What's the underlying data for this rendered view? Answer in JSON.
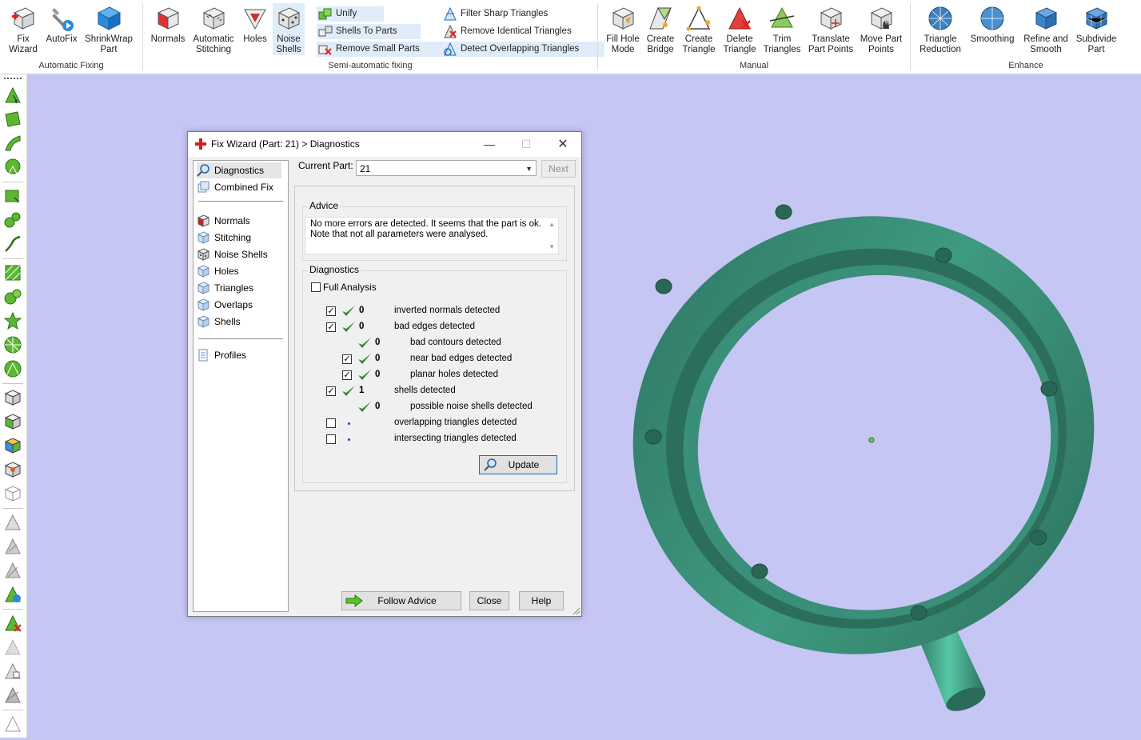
{
  "ribbon": {
    "automatic_fixing": {
      "label": "Automatic Fixing",
      "buttons": [
        {
          "label_1": "Fix",
          "label_2": "Wizard",
          "icon": "fix-wizard-icon"
        },
        {
          "label_1": "AutoFix",
          "label_2": "",
          "icon": "autofix-icon"
        },
        {
          "label_1": "ShrinkWrap",
          "label_2": "Part",
          "icon": "shrinkwrap-icon"
        }
      ]
    },
    "semi_automatic": {
      "label": "Semi-automatic fixing",
      "big_buttons": [
        {
          "label_1": "Normals",
          "label_2": "",
          "icon": "normals-icon"
        },
        {
          "label_1": "Automatic",
          "label_2": "Stitching",
          "icon": "stitching-icon"
        },
        {
          "label_1": "Holes",
          "label_2": "",
          "icon": "holes-icon"
        },
        {
          "label_1": "Noise",
          "label_2": "Shells",
          "icon": "noise-shells-icon"
        }
      ],
      "small_buttons": [
        "Unify",
        "Shells To Parts",
        "Remove Small Parts"
      ],
      "triangle_buttons": [
        "Filter Sharp Triangles",
        "Remove Identical Triangles",
        "Detect Overlapping Triangles"
      ]
    },
    "manual": {
      "label": "Manual",
      "buttons": [
        {
          "label_1": "Fill Hole",
          "label_2": "Mode",
          "icon": "fill-hole-icon"
        },
        {
          "label_1": "Create",
          "label_2": "Bridge",
          "icon": "create-bridge-icon"
        },
        {
          "label_1": "Create",
          "label_2": "Triangle",
          "icon": "create-triangle-icon"
        },
        {
          "label_1": "Delete",
          "label_2": "Triangle",
          "icon": "delete-triangle-icon"
        },
        {
          "label_1": "Trim",
          "label_2": "Triangles",
          "icon": "trim-triangles-icon"
        },
        {
          "label_1": "Translate",
          "label_2": "Part Points",
          "icon": "translate-points-icon"
        },
        {
          "label_1": "Move Part",
          "label_2": "Points",
          "icon": "move-points-icon"
        }
      ]
    },
    "enhance": {
      "label": "Enhance",
      "buttons": [
        {
          "label_1": "Triangle",
          "label_2": "Reduction",
          "icon": "triangle-reduction-icon"
        },
        {
          "label_1": "Smoothing",
          "label_2": "",
          "icon": "smoothing-icon"
        },
        {
          "label_1": "Refine and",
          "label_2": "Smooth",
          "icon": "refine-smooth-icon"
        },
        {
          "label_1": "Subdivide",
          "label_2": "Part",
          "icon": "subdivide-icon"
        }
      ]
    }
  },
  "dialog": {
    "title": "Fix Wizard (Part: 21) > Diagnostics",
    "nav": {
      "top": [
        "Diagnostics",
        "Combined Fix"
      ],
      "middle": [
        "Normals",
        "Stitching",
        "Noise Shells",
        "Holes",
        "Triangles",
        "Overlaps",
        "Shells"
      ],
      "bottom": [
        "Profiles"
      ]
    },
    "current_part_label": "Current Part:",
    "current_part_value": "21",
    "next_label": "Next",
    "advice_title": "Advice",
    "advice_line1": "No more errors are detected. It seems that the part is ok.",
    "advice_line2": "Note that not all parameters were analysed.",
    "diagnostics_title": "Diagnostics",
    "full_analysis_label": "Full Analysis",
    "rows": [
      {
        "checked": true,
        "status": "ok",
        "count": "0",
        "text": "inverted normals detected",
        "indent": 0
      },
      {
        "checked": true,
        "status": "ok",
        "count": "0",
        "text": "bad edges detected",
        "indent": 0
      },
      {
        "checked": null,
        "status": "ok",
        "count": "0",
        "text": "bad contours detected",
        "indent": 1
      },
      {
        "checked": true,
        "status": "ok",
        "count": "0",
        "text": "near bad edges detected",
        "indent": 1
      },
      {
        "checked": true,
        "status": "ok",
        "count": "0",
        "text": "planar holes detected",
        "indent": 1
      },
      {
        "checked": true,
        "status": "ok",
        "count": "1",
        "text": "shells detected",
        "indent": 0
      },
      {
        "checked": null,
        "status": "ok",
        "count": "0",
        "text": "possible noise shells detected",
        "indent": 1
      },
      {
        "checked": false,
        "status": "none",
        "count": "",
        "text": "overlapping triangles detected",
        "indent": 0
      },
      {
        "checked": false,
        "status": "none",
        "count": "",
        "text": "intersecting triangles detected",
        "indent": 0
      }
    ],
    "update_label": "Update",
    "follow_advice_label": "Follow Advice",
    "close_label": "Close",
    "help_label": "Help"
  },
  "colors": {
    "viewport_bg": "#c6c6f5",
    "part_color": "#3a8f78",
    "tick_green": "#1d8a2d"
  }
}
